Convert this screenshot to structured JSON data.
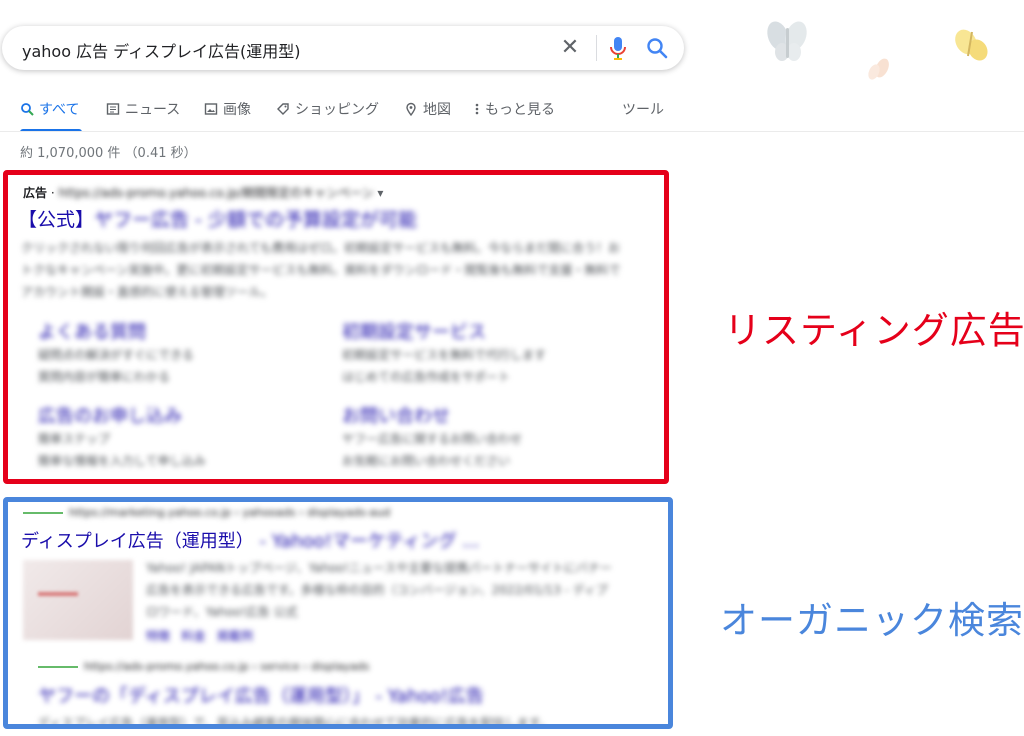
{
  "search": {
    "query": "yahoo 広告 ディスプレイ広告(運用型)",
    "clear_symbol": "✕"
  },
  "tabs": [
    {
      "label": "すべて",
      "icon": "search-icon",
      "active": true
    },
    {
      "label": "ニュース",
      "icon": "news-icon"
    },
    {
      "label": "画像",
      "icon": "image-icon"
    },
    {
      "label": "ショッピング",
      "icon": "tag-icon"
    },
    {
      "label": "地図",
      "icon": "location-icon"
    },
    {
      "label": "もっと見る",
      "icon": "more-vertical-icon"
    }
  ],
  "tools_label": "ツール",
  "result_stats": "約 1,070,000 件 （0.41 秒）",
  "ad": {
    "badge": "広告",
    "separator": " · ",
    "url": "https://ads-promo.yahoo.co.jp/期間限定のキャンペーン",
    "title_prefix": "【公式】",
    "title_rest": "ヤフー広告 - 少額での予算設定が可能",
    "description": "クリックされない限り何回広告が表示されても費用はゼロ。初期設定サービスも無料。今ならまだ間に合う！おトクなキャンペーン実施中。更に初期設定サービスも無料。資料をダウンロード・閲覧後も無料で支援・無料でアカウント開設・直感的に使える管理ツール。",
    "sitelinks": [
      {
        "title": "よくある質問",
        "line1": "疑問点の解決がすぐにできる",
        "line2": "質問内容が簡単にわかる"
      },
      {
        "title": "初期設定サービス",
        "line1": "初期設定サービスを無料で代行します",
        "line2": "はじめての広告作成をサポート"
      },
      {
        "title": "広告のお申し込み",
        "line1": "簡単ステップ",
        "line2": "簡単な情報を入力して申し込み"
      },
      {
        "title": "お問い合わせ",
        "line1": "ヤフー広告に関するお問い合わせ",
        "line2": "お気軽にお問い合わせください"
      }
    ]
  },
  "organic": [
    {
      "url": "https://marketing.yahoo.co.jp › yahooads › displayads-aud",
      "title": "ディスプレイ広告（運用型）",
      "title_suffix": " - Yahoo!マーケティング ...",
      "description": "Yahoo! JAPANトップページ、Yahoo!ニュースや主要な提携パートナーサイトにバナー広告を表示できる広告です。多様な枠の目的（コンバージョン、2022/01/13 - ディプロワード、Yahoo!広告 公式",
      "links": [
        "特徴",
        "料金",
        "掲載例"
      ]
    },
    {
      "url": "https://ads-promo.yahoo.co.jp › service › displayads",
      "title": "ヤフーの「ディスプレイ広告（運用型）」 - Yahoo!広告",
      "description": "ディスプレイ広告（運用型）で、見込み顧客の興味関心に合わせて効果的に広告を配信します。"
    }
  ],
  "annotations": {
    "listing": "リスティング広告",
    "organic": "オーガニック検索"
  },
  "colors": {
    "listing_box": "#e5001a",
    "organic_box": "#4a86dc",
    "link": "#1a0dab",
    "active_tab": "#1a73e8"
  }
}
